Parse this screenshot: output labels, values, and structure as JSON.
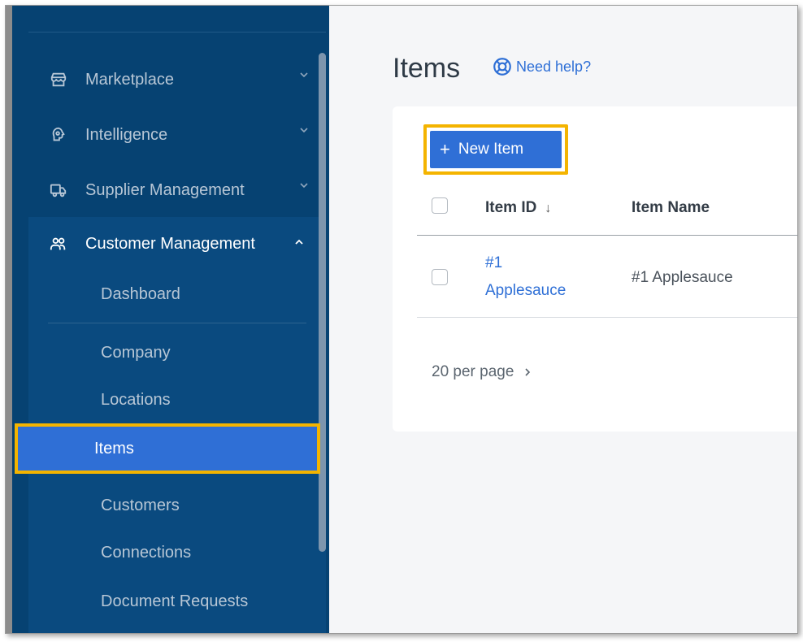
{
  "sidebar": {
    "items": [
      {
        "label": "Marketplace",
        "icon": "store-icon"
      },
      {
        "label": "Intelligence",
        "icon": "brain-head-icon"
      },
      {
        "label": "Supplier Management",
        "icon": "truck-icon"
      },
      {
        "label": "Customer Management",
        "icon": "users-icon"
      }
    ],
    "sub_items": [
      {
        "label": "Dashboard"
      },
      {
        "label": "Company"
      },
      {
        "label": "Locations"
      },
      {
        "label": "Items"
      },
      {
        "label": "Customers"
      },
      {
        "label": "Connections"
      },
      {
        "label": "Document Requests"
      }
    ]
  },
  "main": {
    "title": "Items",
    "help_label": "Need help?",
    "new_item_label": "New Item",
    "table": {
      "columns": [
        "Item ID",
        "Item Name"
      ],
      "sort_indicator": "↓",
      "rows": [
        {
          "id_line1": "#1",
          "id_line2": "Applesauce",
          "name": "#1 Applesauce"
        }
      ]
    },
    "pagination": {
      "per_page_label": "20 per page"
    }
  },
  "colors": {
    "sidebar_bg": "#064272",
    "sidebar_active_bg": "#0a4a7f",
    "accent_blue": "#2f6fd6",
    "highlight": "#f4b400"
  }
}
